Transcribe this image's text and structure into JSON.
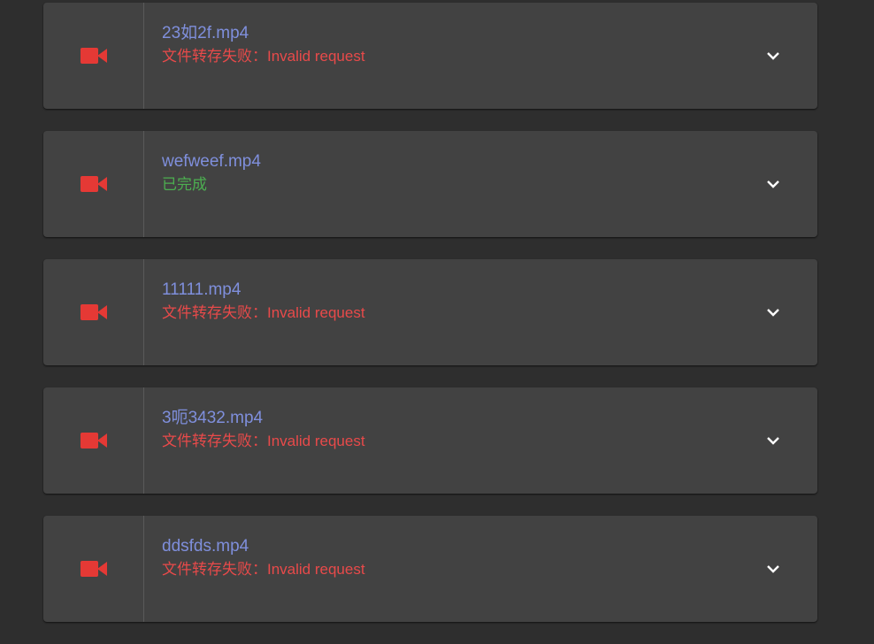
{
  "colors": {
    "background": "#2e2e2e",
    "card": "#424242",
    "filename": "#7f8fdc",
    "status_fail": "#e84a4a",
    "status_ok": "#4caf50",
    "icon": "#e53935"
  },
  "items": [
    {
      "icon": "videocam-icon",
      "filename": "23如2f.mp4",
      "status": "文件转存失败：Invalid request",
      "status_type": "fail"
    },
    {
      "icon": "videocam-icon",
      "filename": "wefweef.mp4",
      "status": "已完成",
      "status_type": "ok"
    },
    {
      "icon": "videocam-icon",
      "filename": "11111.mp4",
      "status": "文件转存失败：Invalid request",
      "status_type": "fail"
    },
    {
      "icon": "videocam-icon",
      "filename": "3呃3432.mp4",
      "status": "文件转存失败：Invalid request",
      "status_type": "fail"
    },
    {
      "icon": "videocam-icon",
      "filename": "ddsfds.mp4",
      "status": "文件转存失败：Invalid request",
      "status_type": "fail"
    }
  ]
}
